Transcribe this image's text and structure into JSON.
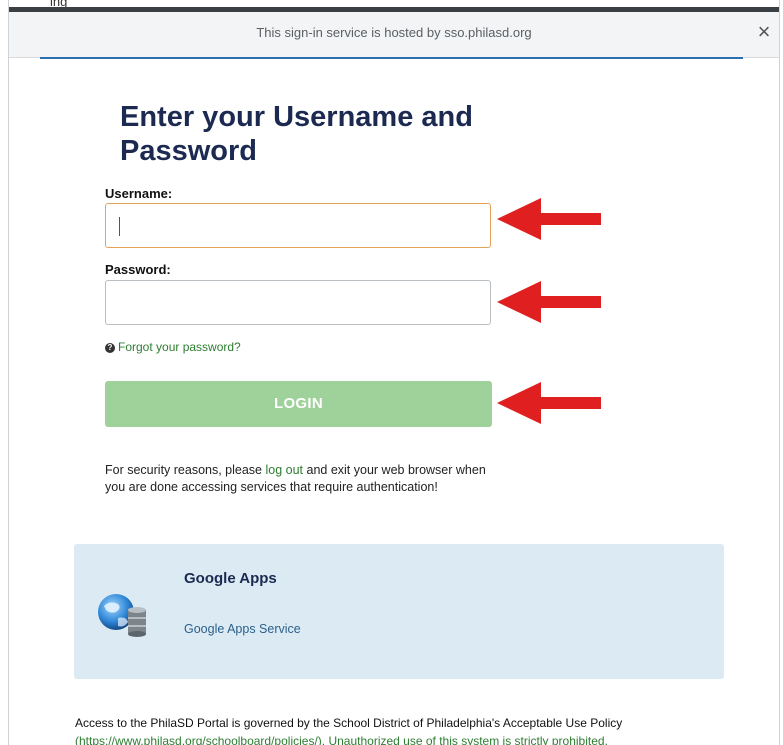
{
  "host": {
    "text": "This sign-in service is hosted by sso.philasd.org",
    "close_glyph": "×"
  },
  "top_fragment": "ing",
  "heading": "Enter your Username and Password",
  "form": {
    "username_label": "Username:",
    "username_value": "",
    "password_label": "Password:",
    "password_value": "",
    "forgot_icon": "question-circle-icon",
    "forgot_text": "Forgot your password?",
    "login_label": "LOGIN"
  },
  "security": {
    "prefix": "For security reasons, please ",
    "link": "log out",
    "suffix": " and exit your web browser when you are done accessing services that require authentication!"
  },
  "apps": [
    {
      "title": "Google Apps",
      "link": "Google Apps Service",
      "icon": "globe-database-icon"
    }
  ],
  "footer": {
    "line1": "Access to the PhilaSD Portal is governed by the School District of Philadelphia's Acceptable Use Policy",
    "line2": "(https://www.philasd.org/schoolboard/policies/). Unauthorized use of this system is strictly prohibited."
  },
  "colors": {
    "accent": "#2b6fb0",
    "heading": "#1c2a52",
    "link_green": "#2e7d32",
    "login_bg": "#9fd19b",
    "arrow_red": "#e02020",
    "card_bg": "#dcebf3"
  }
}
